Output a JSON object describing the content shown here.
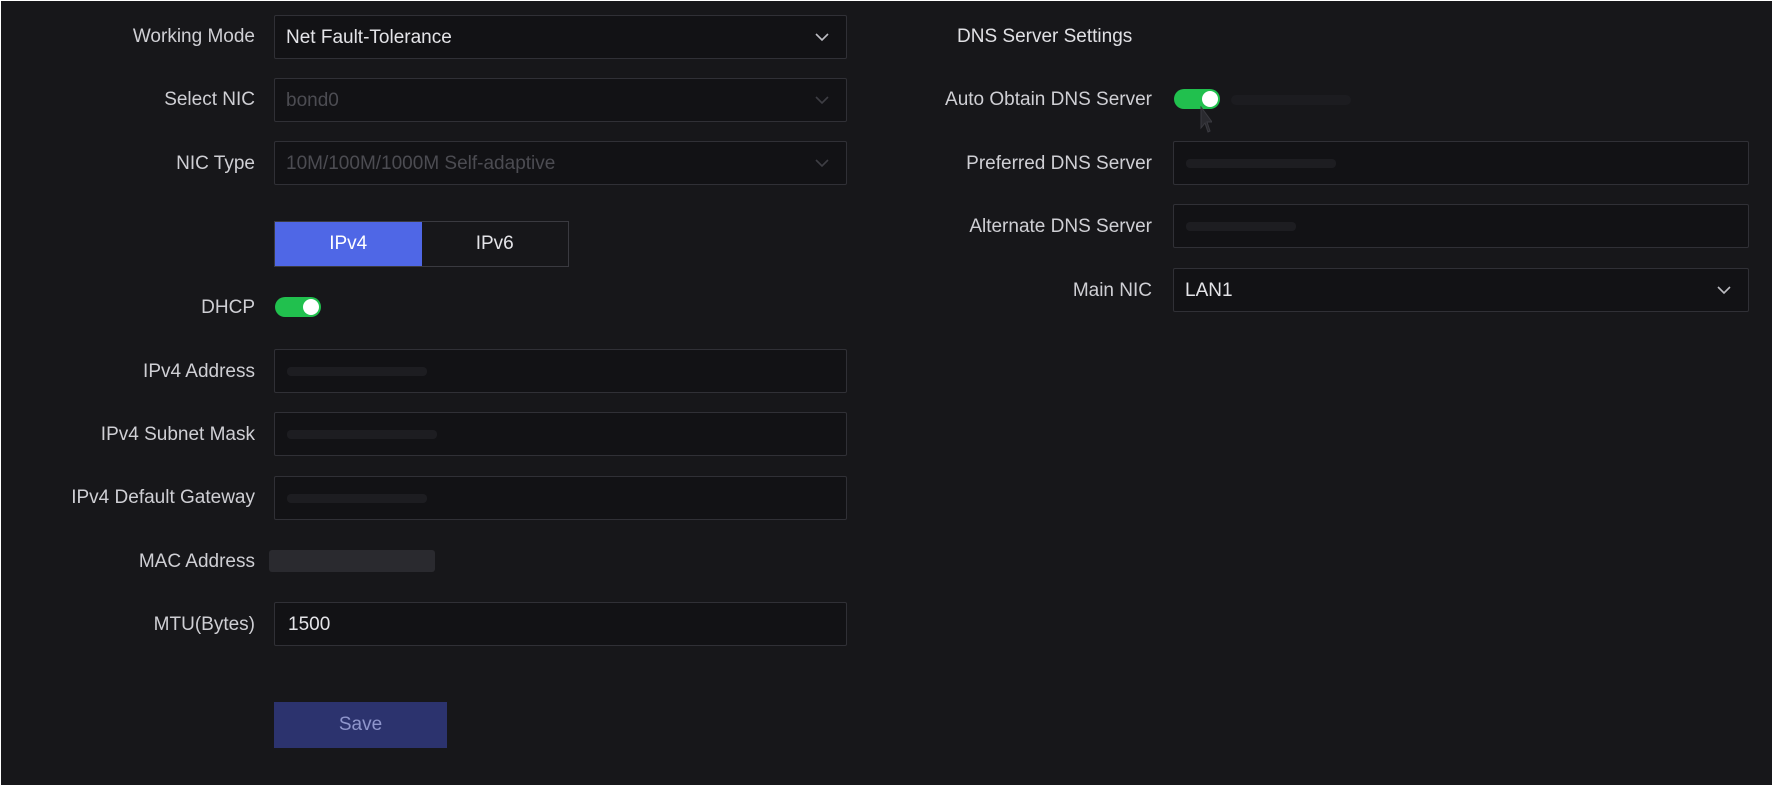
{
  "left": {
    "working_mode": {
      "label": "Working Mode",
      "value": "Net Fault-Tolerance",
      "icon": "chevron-down-icon"
    },
    "select_nic": {
      "label": "Select NIC",
      "value": "bond0",
      "icon": "chevron-down-icon"
    },
    "nic_type": {
      "label": "NIC Type",
      "value": "10M/100M/1000M Self-adaptive",
      "icon": "chevron-down-icon"
    },
    "ip_tabs": [
      {
        "label": "IPv4",
        "active": true
      },
      {
        "label": "IPv6",
        "active": false
      }
    ],
    "dhcp": {
      "label": "DHCP",
      "on": true
    },
    "ipv4_address": {
      "label": "IPv4 Address",
      "value": ""
    },
    "ipv4_subnet_mask": {
      "label": "IPv4 Subnet Mask",
      "value": ""
    },
    "ipv4_default_gateway": {
      "label": "IPv4 Default Gateway",
      "value": ""
    },
    "mac_address": {
      "label": "MAC Address",
      "value": ""
    },
    "mtu": {
      "label": "MTU(Bytes)",
      "value": "1500"
    },
    "save_label": "Save"
  },
  "right": {
    "title": "DNS Server Settings",
    "auto_obtain": {
      "label": "Auto Obtain DNS Server",
      "on": true
    },
    "preferred_dns": {
      "label": "Preferred DNS Server",
      "value": ""
    },
    "alternate_dns": {
      "label": "Alternate DNS Server",
      "value": ""
    },
    "main_nic": {
      "label": "Main NIC",
      "value": "LAN1",
      "icon": "chevron-down-icon"
    }
  },
  "colors": {
    "background": "#17171a",
    "field_background": "#121215",
    "field_border": "#303036",
    "accent": "#4f67e6",
    "toggle_on": "#21c04e",
    "save_button": "#2c336e"
  }
}
